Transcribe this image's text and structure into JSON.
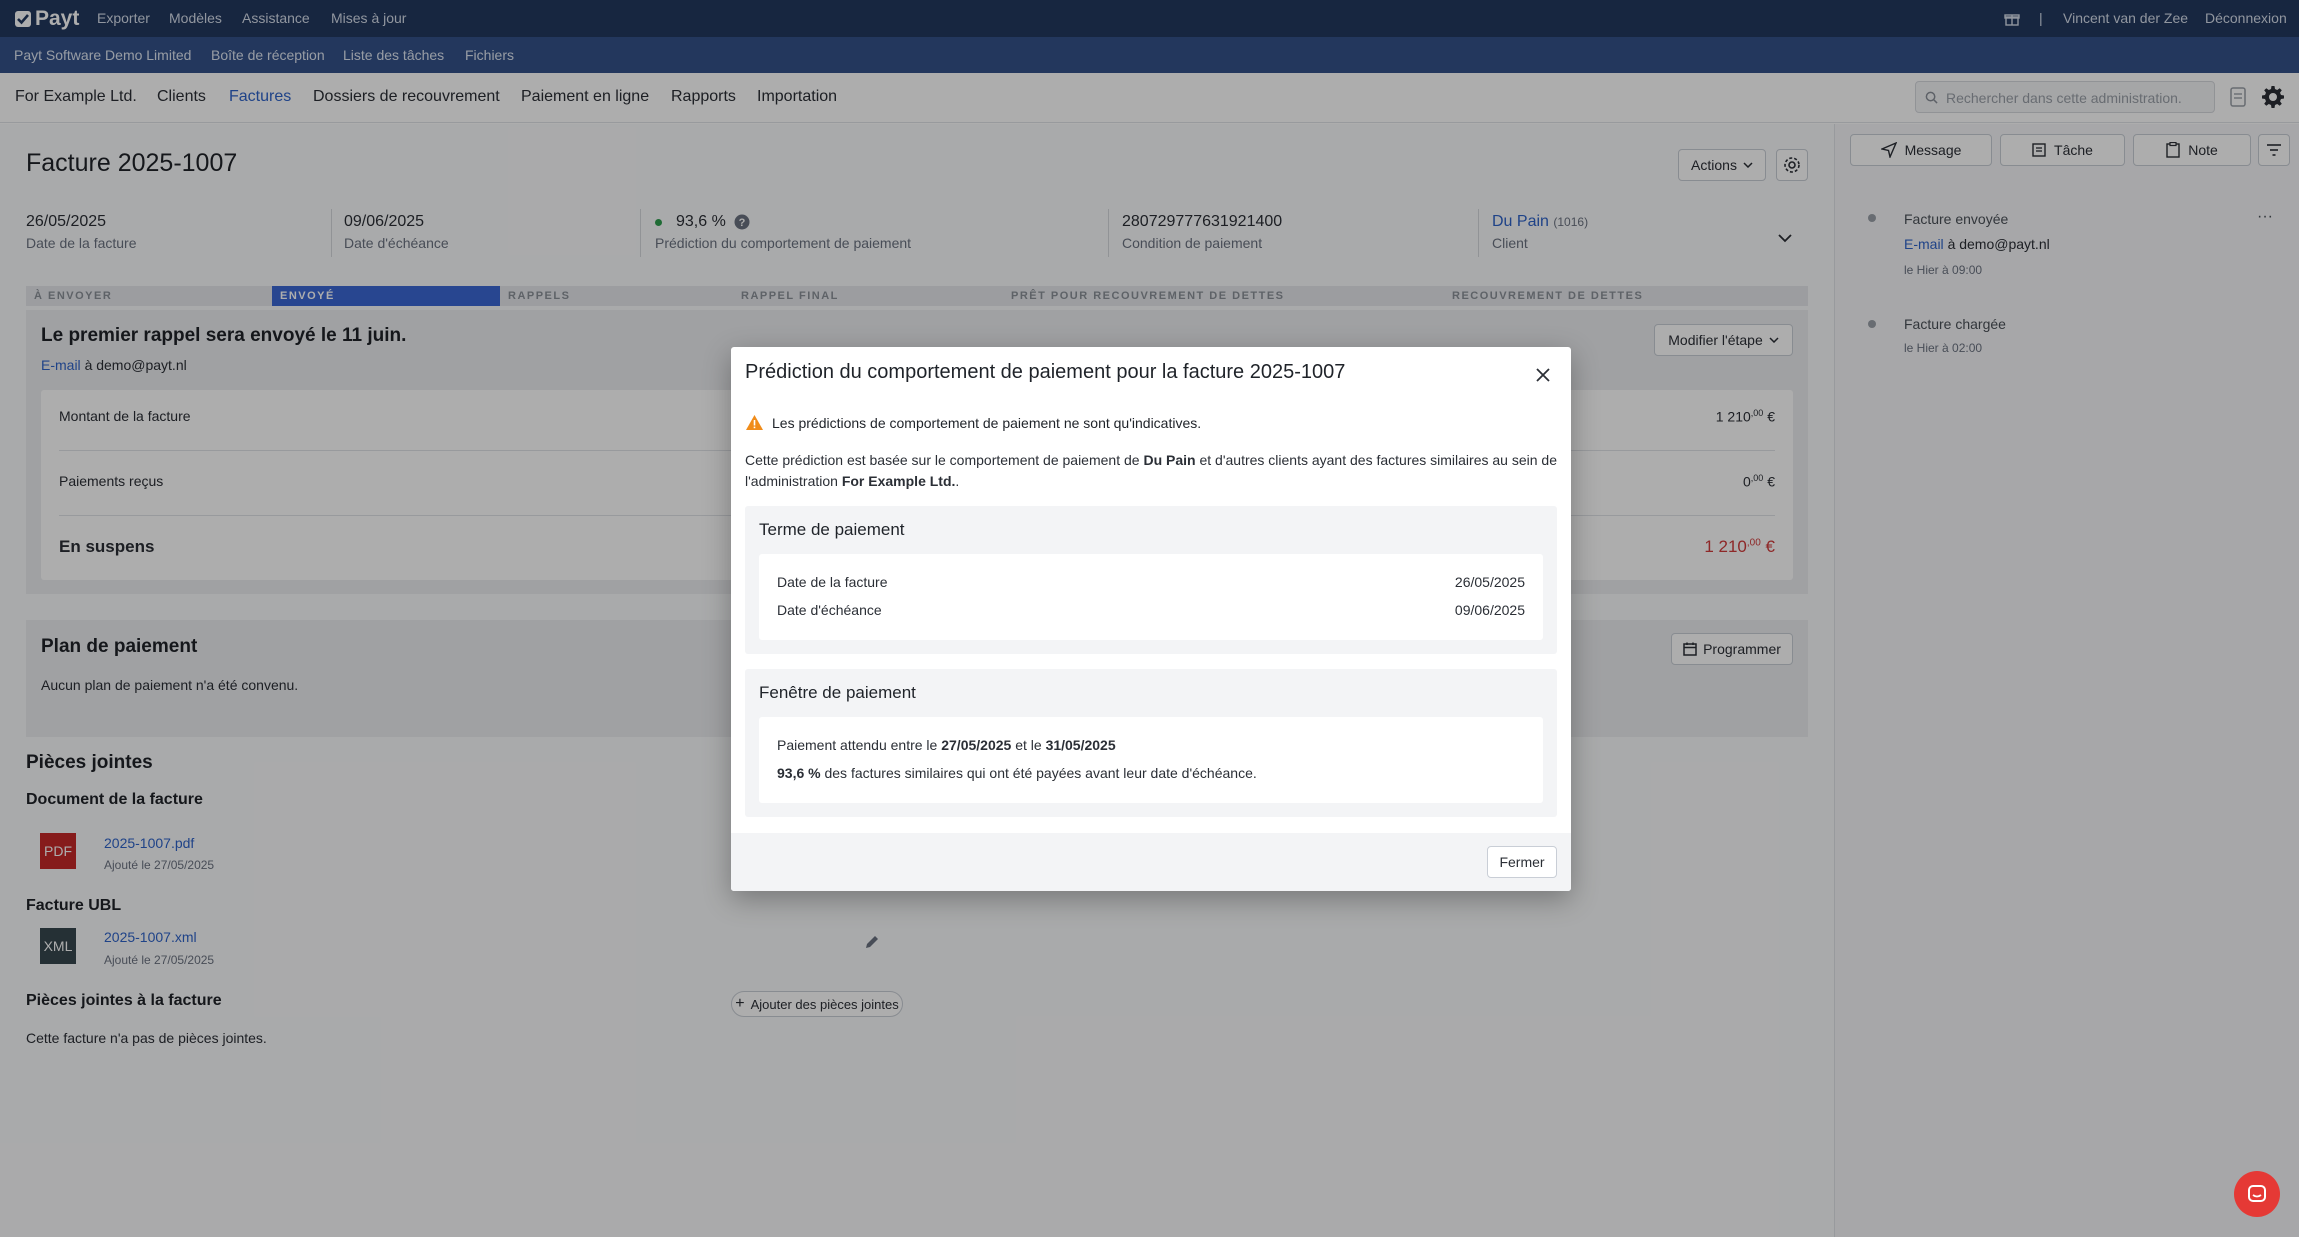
{
  "topbar": {
    "logo": "Payt",
    "nav": [
      "Exporter",
      "Modèles",
      "Assistance",
      "Mises à jour"
    ],
    "separator": "|",
    "user": "Vincent van der Zee",
    "logout": "Déconnexion"
  },
  "subbar": [
    "Payt Software Demo Limited",
    "Boîte de réception",
    "Liste des tâches",
    "Fichiers"
  ],
  "mainnav": {
    "items": [
      "For Example Ltd.",
      "Clients",
      "Factures",
      "Dossiers de recouvrement",
      "Paiement en ligne",
      "Rapports",
      "Importation"
    ],
    "active": "Factures",
    "search_placeholder": "Rechercher dans cette administration."
  },
  "invoice": {
    "title": "Facture 2025-1007",
    "actions_label": "Actions",
    "fields": {
      "invoice_date": "26/05/2025",
      "invoice_date_label": "Date de la facture",
      "due_date": "09/06/2025",
      "due_date_label": "Date d'échéance",
      "prediction": "93,6 %",
      "prediction_label": "Prédiction du comportement de paiement",
      "condition": "280729777631921400",
      "condition_label": "Condition de paiement",
      "client_name": "Du Pain",
      "client_id": "(1016)",
      "client_label": "Client"
    },
    "stages": [
      "À ENVOYER",
      "ENVOYÉ",
      "RAPPELS",
      "RAPPEL FINAL",
      "PRÊT POUR RECOUVREMENT DE DETTES",
      "RECOUVREMENT DE DETTES"
    ],
    "active_stage": 1,
    "reminder": {
      "title": "Le premier rappel sera envoyé le 11 juin.",
      "channel": "E-mail",
      "recipient": "à demo@payt.nl",
      "modify_label": "Modifier l'étape"
    },
    "amounts": {
      "amount_label": "Montant de la facture",
      "amount_int": "1 210",
      "amount_dec": ",00",
      "paid_label": "Paiements reçus",
      "paid_int": "0",
      "paid_dec": ",00",
      "open_label": "En suspens",
      "open_int": "1 210",
      "open_dec": ",00",
      "currency": "€"
    },
    "plan": {
      "title": "Plan de paiement",
      "text": "Aucun plan de paiement n'a été convenu.",
      "schedule_label": "Programmer"
    },
    "attachments": {
      "title": "Pièces jointes",
      "doc_title": "Document de la facture",
      "pdf_badge": "PDF",
      "pdf_name": "2025-1007.pdf",
      "pdf_added": "Ajouté le 27/05/2025",
      "ubl_title": "Facture UBL",
      "xml_badge": "XML",
      "xml_name": "2025-1007.xml",
      "xml_added": "Ajouté le 27/05/2025",
      "extra_title": "Pièces jointes à la facture",
      "add_label": "Ajouter des pièces jointes",
      "empty_text": "Cette facture n'a pas de pièces jointes."
    }
  },
  "sidebar": {
    "buttons": [
      "Message",
      "Tâche",
      "Note"
    ],
    "events": [
      {
        "title": "Facture envoyée",
        "channel": "E-mail",
        "detail": "à demo@payt.nl",
        "time": "le Hier à 09:00"
      },
      {
        "title": "Facture chargée",
        "time": "le Hier à 02:00"
      }
    ],
    "more": "···"
  },
  "modal": {
    "title": "Prédiction du comportement de paiement pour la facture 2025-1007",
    "warning": "Les prédictions de comportement de paiement ne sont qu'indicatives.",
    "desc_1": "Cette prédiction est basée sur le comportement de paiement de ",
    "desc_client": "Du Pain",
    "desc_2": " et d'autres clients ayant des factures similaires au sein de",
    "desc_3": "l'administration ",
    "desc_admin": "For Example Ltd.",
    "desc_4": ".",
    "term": {
      "title": "Terme de paiement",
      "invoice_date_label": "Date de la facture",
      "invoice_date": "26/05/2025",
      "due_date_label": "Date d'échéance",
      "due_date": "09/06/2025"
    },
    "window": {
      "title": "Fenêtre de paiement",
      "expected_1": "Paiement attendu entre le ",
      "start": "27/05/2025",
      "expected_2": " et le ",
      "end": "31/05/2025",
      "percent": "93,6 %",
      "percent_text": " des factures similaires qui ont été payées avant leur date d'échéance."
    },
    "close_label": "Fermer"
  },
  "colors": {
    "topbar": "#22385f",
    "subbar": "#34528a",
    "accent": "#2f63c9",
    "stage_active": "#3b67d4",
    "overdue": "#d23b3b",
    "warning": "#f08c1a",
    "pdf": "#c62828",
    "xml": "#37474f",
    "chat": "#e53935"
  }
}
